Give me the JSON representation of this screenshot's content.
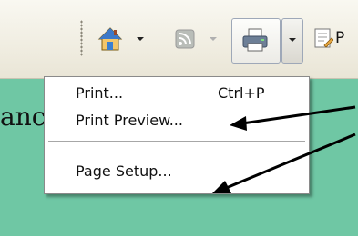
{
  "background_text": "anc",
  "toolbar": {
    "page_label": "P",
    "icons": [
      "home-icon",
      "feed-icon",
      "printer-icon",
      "page-icon"
    ]
  },
  "print_menu": {
    "items": [
      {
        "label": "Print...",
        "shortcut": "Ctrl+P"
      },
      {
        "label": "Print Preview...",
        "shortcut": ""
      },
      {
        "label": "Page Setup...",
        "shortcut": ""
      }
    ]
  },
  "colors": {
    "page_background": "#6fc7a4",
    "menu_background": "#ffffff",
    "toolbar_background": "#f0ede1"
  }
}
